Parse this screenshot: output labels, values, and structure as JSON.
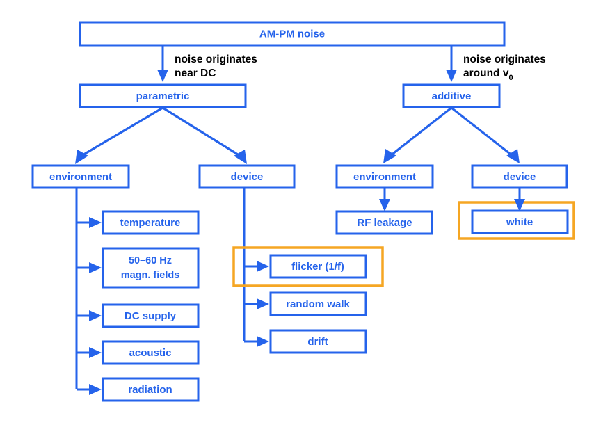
{
  "diagram": {
    "title": "AM-PM noise",
    "colors": {
      "node_stroke": "#2563eb",
      "node_text": "#2563eb",
      "node_fill": "#ffffff",
      "annotation_text": "#000000",
      "highlight_stroke": "#f5a623",
      "background": "#ffffff"
    },
    "root": {
      "label": "AM-PM noise"
    },
    "annotations": [
      {
        "id": "annotation-parametric",
        "line1": "noise originates",
        "line2": "near DC",
        "sub": ""
      },
      {
        "id": "annotation-additive",
        "line1": "noise originates",
        "line2": "around v",
        "sub": "0"
      }
    ],
    "branches": [
      {
        "id": "parametric",
        "label": "parametric",
        "children": [
          {
            "id": "parametric-environment",
            "label": "environment",
            "leaves": [
              {
                "id": "temperature",
                "label": "temperature",
                "highlighted": false
              },
              {
                "id": "magnetic-fields",
                "label": "50–60 Hz\nmagn. fields",
                "line1": "50–60 Hz",
                "line2": "magn. fields",
                "highlighted": false
              },
              {
                "id": "dc-supply",
                "label": "DC supply",
                "highlighted": false
              },
              {
                "id": "acoustic",
                "label": "acoustic",
                "highlighted": false
              },
              {
                "id": "radiation",
                "label": "radiation",
                "highlighted": false
              }
            ]
          },
          {
            "id": "parametric-device",
            "label": "device",
            "leaves": [
              {
                "id": "flicker",
                "label": "flicker (1/f)",
                "highlighted": true
              },
              {
                "id": "random-walk",
                "label": "random walk",
                "highlighted": false
              },
              {
                "id": "drift",
                "label": "drift",
                "highlighted": false
              }
            ]
          }
        ]
      },
      {
        "id": "additive",
        "label": "additive",
        "children": [
          {
            "id": "additive-environment",
            "label": "environment",
            "leaves": [
              {
                "id": "rf-leakage",
                "label": "RF leakage",
                "highlighted": false
              }
            ]
          },
          {
            "id": "additive-device",
            "label": "device",
            "leaves": [
              {
                "id": "white",
                "label": "white",
                "highlighted": true
              }
            ]
          }
        ]
      }
    ]
  }
}
